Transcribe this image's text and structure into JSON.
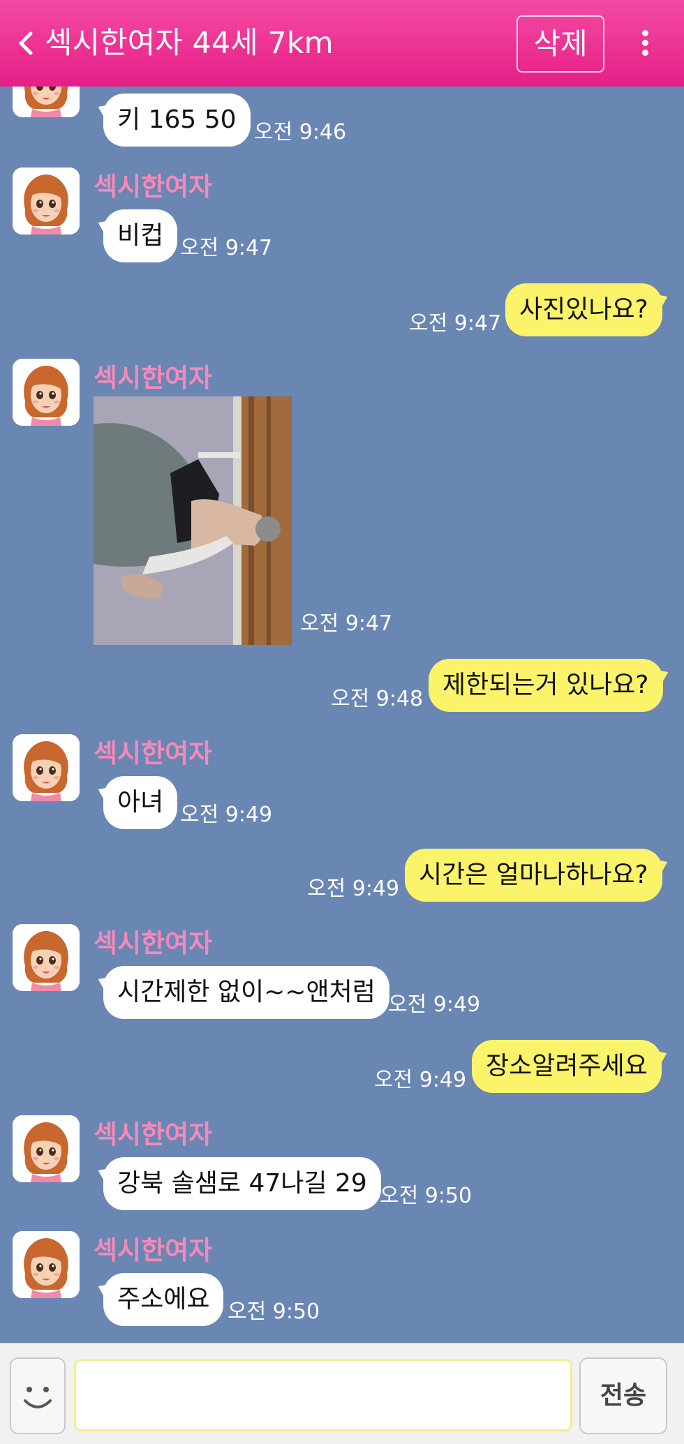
{
  "header": {
    "title": "섹시한여자 44세 7km",
    "delete_label": "삭제"
  },
  "sender_name": "섹시한여자",
  "messages": [
    {
      "dir": "in",
      "text": "키 165  50",
      "time": "오전 9:46"
    },
    {
      "dir": "in",
      "text": "비컵",
      "time": "오전 9:47"
    },
    {
      "dir": "out",
      "text": "사진있나요?",
      "time": "오전 9:47"
    },
    {
      "dir": "in",
      "type": "photo",
      "time": "오전 9:47"
    },
    {
      "dir": "out",
      "text": "제한되는거 있나요?",
      "time": "오전 9:48"
    },
    {
      "dir": "in",
      "text": "아녀",
      "time": "오전 9:49"
    },
    {
      "dir": "out",
      "text": "시간은 얼마나하나요?",
      "time": "오전 9:49"
    },
    {
      "dir": "in",
      "text": "시간제한 없이~~앤처럼",
      "time": "오전 9:49"
    },
    {
      "dir": "out",
      "text": "장소알려주세요",
      "time": "오전 9:49"
    },
    {
      "dir": "in",
      "text": "강북 솔샘로 47나길 29",
      "time": "오전 9:50"
    },
    {
      "dir": "in",
      "text": "주소에요",
      "time": "오전 9:50"
    }
  ],
  "input": {
    "placeholder": "",
    "send_label": "전송"
  },
  "colors": {
    "header": "#e51f86",
    "background": "#6a86b3",
    "outgoing_bubble": "#fbf36a",
    "sender_name": "#f48ab9"
  },
  "icons": {
    "back": "chevron-left-icon",
    "more": "more-vertical-icon",
    "emoji": "smiley-icon"
  }
}
